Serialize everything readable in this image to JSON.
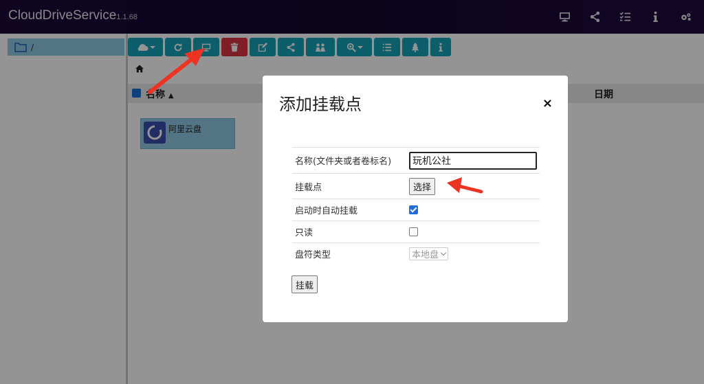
{
  "app": {
    "name": "CloudDriveService",
    "version": "1.1.68"
  },
  "nav_icons": [
    "monitor-icon",
    "share-icon",
    "tasks-icon",
    "info-icon",
    "settings-icon"
  ],
  "sidebar": {
    "items": [
      {
        "label": "/",
        "icon": "folder-icon"
      }
    ]
  },
  "toolbar": {
    "buttons": [
      {
        "name": "cloud-dropdown-button",
        "icon": "cloud-icon"
      },
      {
        "name": "refresh-button",
        "icon": "refresh-icon"
      },
      {
        "name": "mount-button",
        "icon": "monitor-icon"
      },
      {
        "name": "delete-button",
        "icon": "trash-icon"
      },
      {
        "name": "rename-button",
        "icon": "edit-icon"
      },
      {
        "name": "share-button",
        "icon": "share-icon"
      },
      {
        "name": "users-button",
        "icon": "users-icon"
      },
      {
        "name": "zoom-dropdown-button",
        "icon": "zoom-icon"
      },
      {
        "name": "list-view-button",
        "icon": "list-icon"
      },
      {
        "name": "tree-button",
        "icon": "tree-icon"
      },
      {
        "name": "info-button",
        "icon": "info-icon"
      }
    ]
  },
  "table": {
    "name_header": "名称",
    "date_header": "日期"
  },
  "files": [
    {
      "name": "阿里云盘"
    }
  ],
  "modal": {
    "title": "添加挂载点",
    "close": "×",
    "fields": {
      "name_label": "名称(文件夹或者卷标名)",
      "name_value": "玩机公社",
      "mount_label": "挂载点",
      "select_button": "选择",
      "auto_mount_label": "启动时自动挂载",
      "auto_mount_checked": true,
      "readonly_label": "只读",
      "readonly_checked": false,
      "drive_type_label": "盘符类型",
      "drive_type_value": "本地盘"
    },
    "submit_label": "挂载"
  },
  "colors": {
    "toolbar": "#17a2b8",
    "danger": "#dc3545",
    "selection": "#8fc8e6",
    "annotation_arrow": "#ee3322"
  }
}
